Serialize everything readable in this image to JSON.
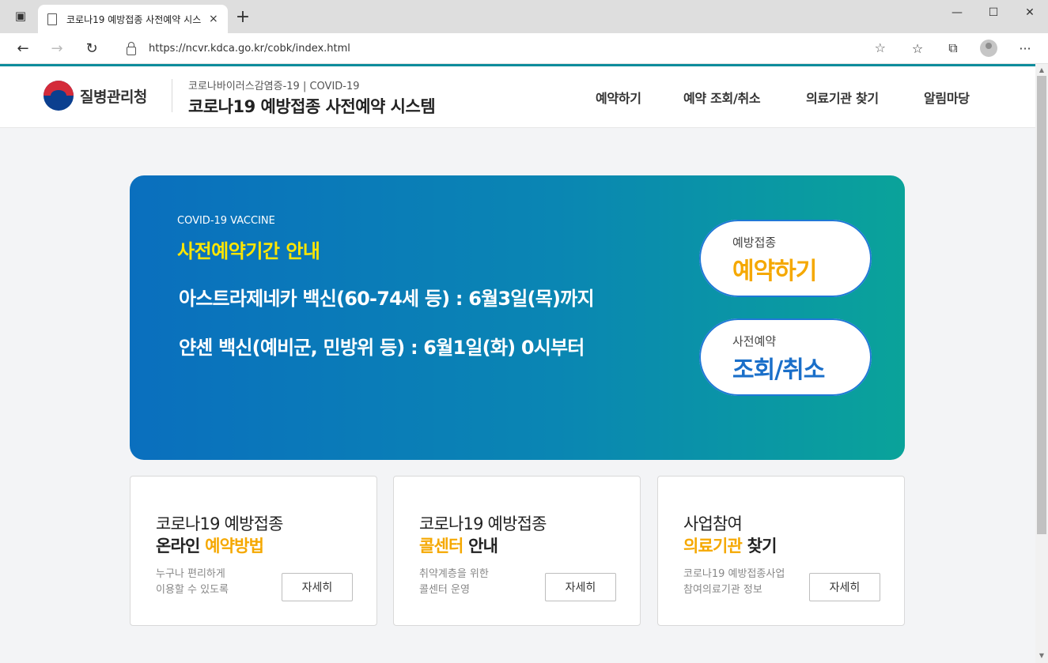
{
  "browser": {
    "tab_title": "코로나19 예방접종 사전예약 시스",
    "tab_close": "×",
    "new_tab": "+",
    "url": "https://ncvr.kdca.go.kr/cobk/index.html",
    "window_controls": {
      "minimize": "—",
      "maximize": "☐",
      "close": "✕"
    },
    "nav": {
      "back": "←",
      "forward": "→",
      "refresh": "↻"
    },
    "icons": {
      "favorite_add": "☆",
      "favorites": "☆",
      "collections": "⧉",
      "more": "···"
    }
  },
  "header": {
    "org_name": "질병관리청",
    "subtitle": "코로나바이러스감염증-19 | COVID-19",
    "title": "코로나19 예방접종 사전예약 시스템",
    "nav": [
      "예약하기",
      "예약 조회/취소",
      "의료기관 찾기",
      "알림마당"
    ]
  },
  "hero": {
    "eyebrow": "COVID-19 VACCINE",
    "heading": "사전예약기간 안내",
    "lines": [
      "아스트라제네카 백신(60-74세 등) : 6월3일(목)까지",
      "얀센 백신(예비군, 민방위 등) : 6월1일(화) 0시부터"
    ],
    "buttons": [
      {
        "small": "예방접종",
        "big": "예약하기",
        "color": "#f5a800"
      },
      {
        "small": "사전예약",
        "big": "조회/취소",
        "color": "#1a6fc9"
      }
    ]
  },
  "cards": [
    {
      "line1": "코로나19 예방접종",
      "line2_highlight": "예약방법",
      "line2_prefix": "온라인 ",
      "line2_suffix": "",
      "desc1": "누구나 편리하게",
      "desc2": "이용할 수 있도록",
      "button": "자세히"
    },
    {
      "line1": "코로나19 예방접종",
      "line2_highlight": "콜센터",
      "line2_prefix": "",
      "line2_suffix": " 안내",
      "desc1": "취약계층을 위한",
      "desc2": "콜센터 운영",
      "button": "자세히"
    },
    {
      "line1": "사업참여",
      "line2_highlight": "의료기관",
      "line2_prefix": "",
      "line2_suffix": " 찾기",
      "desc1": "코로나19 예방접종사업",
      "desc2": "참여의료기관 정보",
      "button": "자세히"
    }
  ],
  "colors": {
    "accent_teal": "#0c8c9c",
    "highlight_yellow": "#ffe600",
    "highlight_orange": "#f5a800",
    "brand_blue": "#1a6fc9"
  }
}
